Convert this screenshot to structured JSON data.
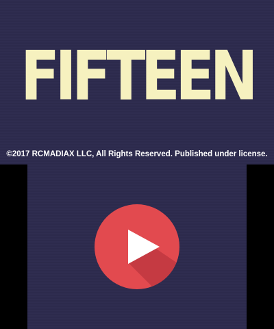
{
  "game": {
    "title": "FIFTEEN",
    "copyright": "©2017 RCMADIAX LLC, All Rights Reserved. Published under license."
  },
  "play_button": {
    "icon": "play-icon",
    "color": "#e24a4f",
    "shadow_color": "#c53a42",
    "icon_color": "#ffffff"
  },
  "colors": {
    "background": "#2d2b4e",
    "title": "#f6f1bf",
    "frame": "#000000"
  }
}
